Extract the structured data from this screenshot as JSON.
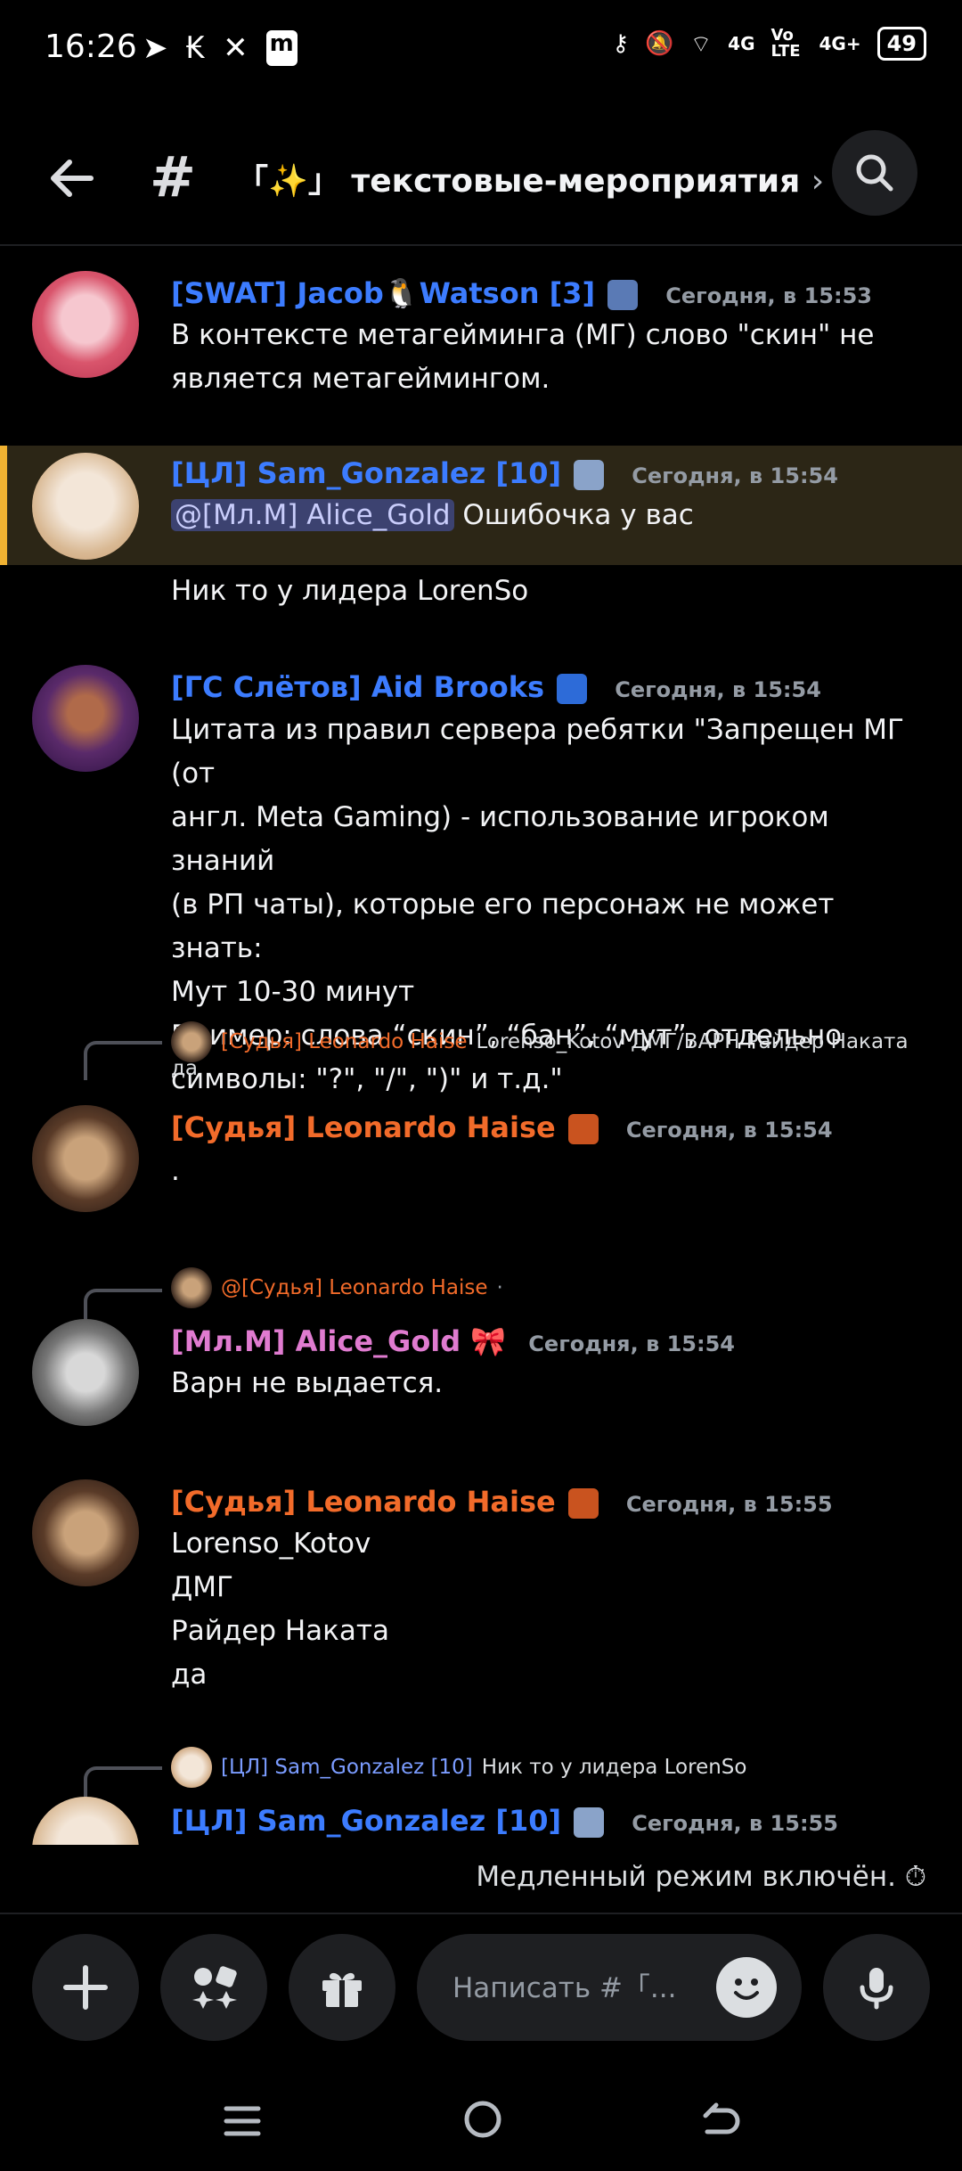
{
  "status_bar": {
    "time": "16:26",
    "battery": "49",
    "network1": "4G",
    "volte": "Vo LTE",
    "network2": "4G+"
  },
  "header": {
    "hash": "#",
    "channel": "「✨」 текстовые-мероприятия",
    "chevron": "›"
  },
  "messages": [
    {
      "author": "[SWAT] Jacob🐧Watson [3]",
      "time": "Сегодня, в 15:53",
      "lines": [
        "В контексте метагейминга (МГ) слово \"скин\" не",
        "является метагеймингом."
      ],
      "color": "#3c7cff"
    },
    {
      "author": "[ЦЛ] Sam_Gonzalez [10]",
      "time": "Сегодня, в 15:54",
      "mention": "@[Мл.М] Alice_Gold",
      "text": "Ошибочка у вас",
      "followup": "Ник то у лидера LorenSo",
      "color": "#3c7cff"
    },
    {
      "author": "[ГС Слётов] Aid Brooks",
      "time": "Сегодня, в 15:54",
      "lines": [
        "Цитата из правил сервера ребятки \"Запрещен МГ (от",
        "англ. Meta Gaming) - использование игроком знаний",
        "(в РП чаты), которые его персонаж не может знать:",
        "Мут 10-30 минут",
        "Пример: слова “скин”, “бан”, “мут”, отдельно",
        "символы: \"?\", \"/\", \")\" и т.д.\""
      ],
      "color": "#3c7cff"
    },
    {
      "reply_author": "[Судья] Leonardo Haise",
      "reply_text": "Lorenso_Kotov ДМГ/ВАРН Райдер Наката",
      "reply_text2": "да",
      "author": "[Судья] Leonardo Haise",
      "time": "Сегодня, в 15:54",
      "text": ".",
      "color": "#f26b2a"
    },
    {
      "reply_author": "@[Судья] Leonardo Haise",
      "reply_dot": "·",
      "author": "[Мл.М] Alice_Gold",
      "emoji": "🎀",
      "time": "Сегодня, в 15:54",
      "text": "Варн не выдается.",
      "color": "#e07bd0"
    },
    {
      "author": "[Судья] Leonardo Haise",
      "time": "Сегодня, в 15:55",
      "lines": [
        "Lorenso_Kotov",
        "ДМГ",
        "Райдер Наката",
        "да"
      ],
      "color": "#f26b2a"
    },
    {
      "reply_author": "[ЦЛ] Sam_Gonzalez [10]",
      "reply_text": "Ник то у лидера LorenSo",
      "author": "[ЦЛ] Sam_Gonzalez [10]",
      "time": "Сегодня, в 15:55",
      "color": "#3c7cff"
    }
  ],
  "slowmode": "Медленный режим включён.",
  "composer": {
    "placeholder": "Написать #「..."
  }
}
